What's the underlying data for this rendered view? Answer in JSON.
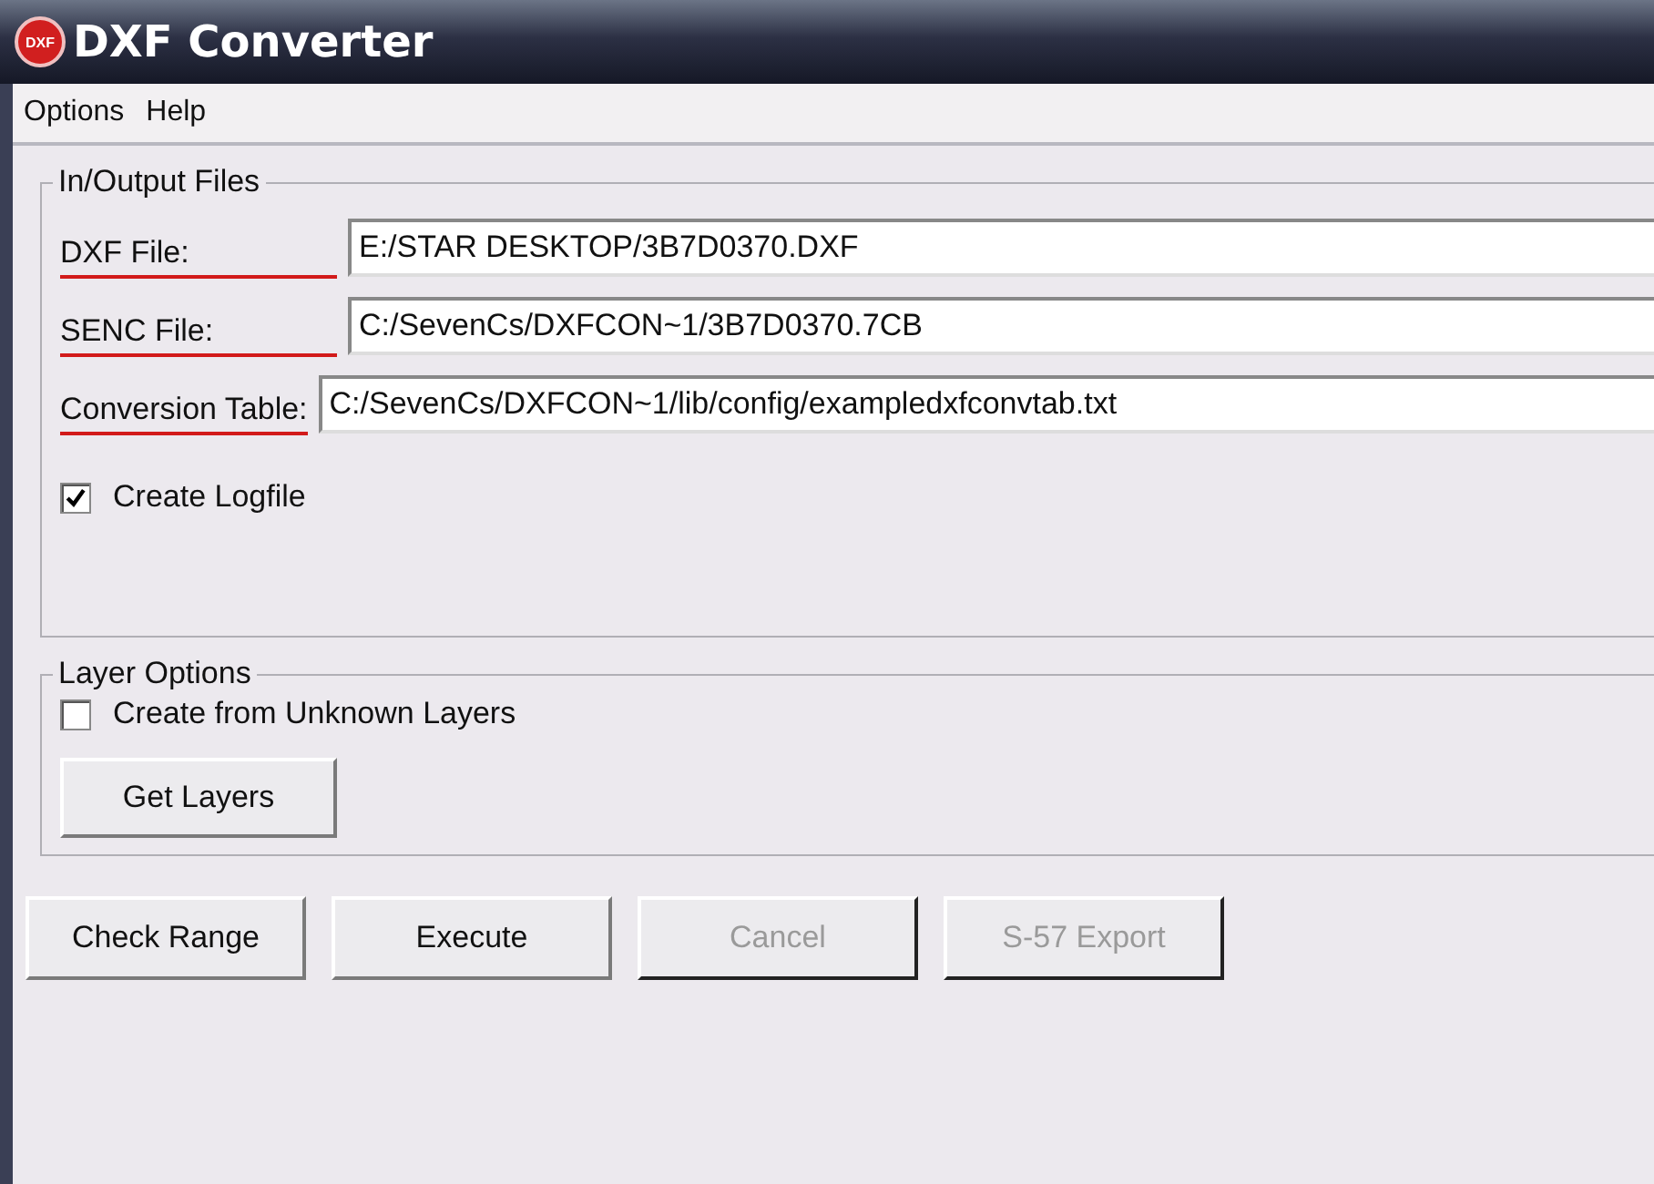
{
  "window": {
    "title": "DXF Converter",
    "logo_text": "DXF"
  },
  "menu": [
    "Options",
    "Help"
  ],
  "files_group": {
    "title": "In/Output Files",
    "fields": [
      {
        "label": "DXF File:",
        "value": "E:/STAR DESKTOP/3B7D0370.DXF"
      },
      {
        "label": "SENC File:",
        "value": "C:/SevenCs/DXFCON~1/3B7D0370.7CB"
      },
      {
        "label": "Conversion Table:",
        "value": "C:/SevenCs/DXFCON~1/lib/config/exampledxfconvtab.txt"
      }
    ],
    "logfile": {
      "label": "Create Logfile",
      "checked": true
    }
  },
  "layer_group": {
    "title": "Layer Options",
    "unknown_layers": {
      "label": "Create from Unknown Layers",
      "checked": false
    },
    "button": {
      "label": "Get Layers",
      "disabled": false
    }
  },
  "buttons": [
    {
      "label": "Check Range",
      "disabled": false
    },
    {
      "label": "Execute",
      "disabled": false
    },
    {
      "label": "Cancel",
      "disabled": true
    },
    {
      "label": "S-57 Export",
      "disabled": true
    }
  ]
}
